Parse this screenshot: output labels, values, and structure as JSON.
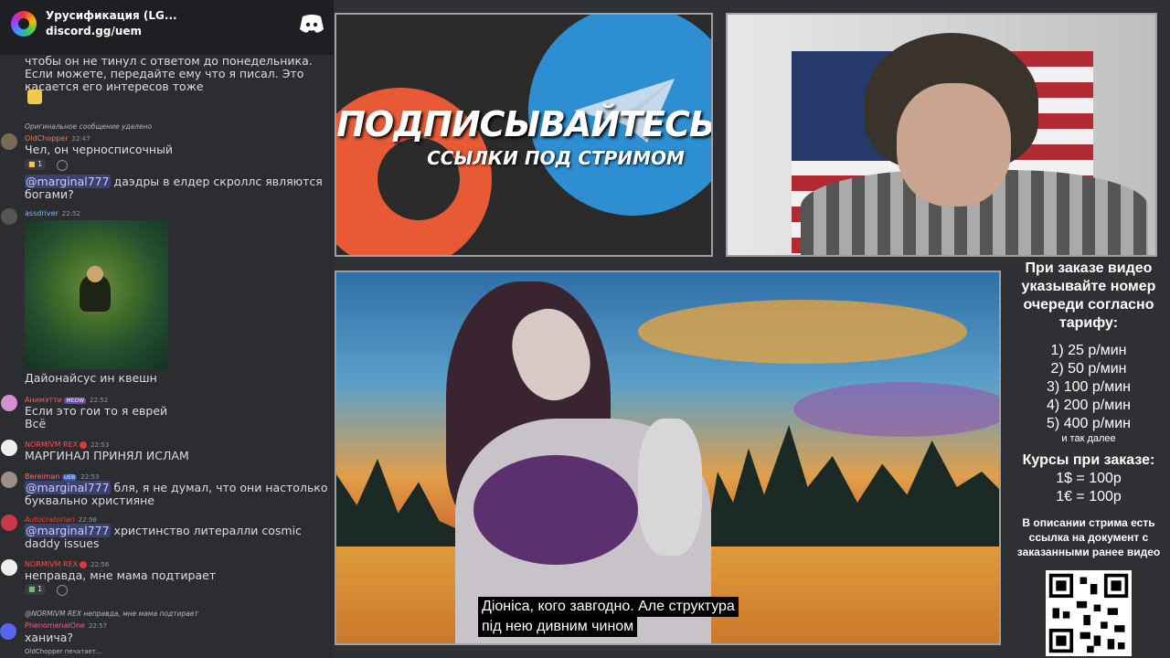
{
  "chat": {
    "server_name": "Урусификация (LG...",
    "server_invite": "discord.gg/uem",
    "messages": [
      {
        "text": "чтобы он не тинул с ответом до понедельника. Если можете, передайте ему что я писал. Это касается его интересов тоже"
      },
      {
        "reply": "Оригинальное сообщение удалено",
        "user": "OldChopper",
        "time": "22:47",
        "text": "Чел, он черносписочный",
        "reaction_count": "1"
      },
      {
        "mention": "@marginal777",
        "text": " даэдры в елдер скроллс являются богами?"
      },
      {
        "user": "assdriver",
        "time": "22:52",
        "text": "Дайонайсус ин квешн"
      },
      {
        "user": "Анимэтти",
        "tag": "MEOW",
        "time": "22:52",
        "text": "Если это гои то я еврей",
        "text2": "Всё"
      },
      {
        "user": "NORMIVM REX",
        "time": "22:53",
        "text": "МАРГИНАЛ ПРИНЯЛ ИСЛАМ"
      },
      {
        "user": "Bereiman",
        "tag": "UEB",
        "time": "22:53",
        "mention": "@marginal777",
        "text": " бля, я не думал, что они настолько буквально християне"
      },
      {
        "user": "Autocratorian",
        "time": "22:56",
        "mention": "@marginal777",
        "text": " христинство литералли cosmic daddy issues"
      },
      {
        "user": "NORMIVM REX",
        "time": "22:56",
        "text": "неправда, мне мама подтирает",
        "reaction_count": "1"
      },
      {
        "reply": "@NORMIVM REX неправда, мне мама подтирает",
        "user": "PhenomenalOne",
        "time": "22:57",
        "text": "ханича?"
      }
    ],
    "typing": "OldChopper печатает..."
  },
  "promo": {
    "title": "ПОДПИСЫВАЙТЕСЬ",
    "subtitle": "ССЫЛКИ ПОД СТРИМОМ"
  },
  "subtitles": {
    "line1": "Діоніса, кого завгодно.  Але структура",
    "line2": "під нею дивним чином"
  },
  "info": {
    "intro": "При заказе видео указывайте номер очереди согласно тарифу:",
    "tariffs": [
      "1) 25 р/мин",
      "2) 50 р/мин",
      "3) 100 р/мин",
      "4) 200 р/мин",
      "5) 400 р/мин"
    ],
    "etc": "и так далее",
    "courses_title": "Курсы при заказе:",
    "courses": [
      "1$ = 100р",
      "1€ = 100р"
    ],
    "description": "В описании стрима есть ссылка на документ с заказанными ранее видео"
  },
  "colors": {
    "accent_mention": "#3c4270",
    "discord_blurple": "#5865f2",
    "patreon": "#e85a36",
    "telegram": "#2d8fd1"
  }
}
